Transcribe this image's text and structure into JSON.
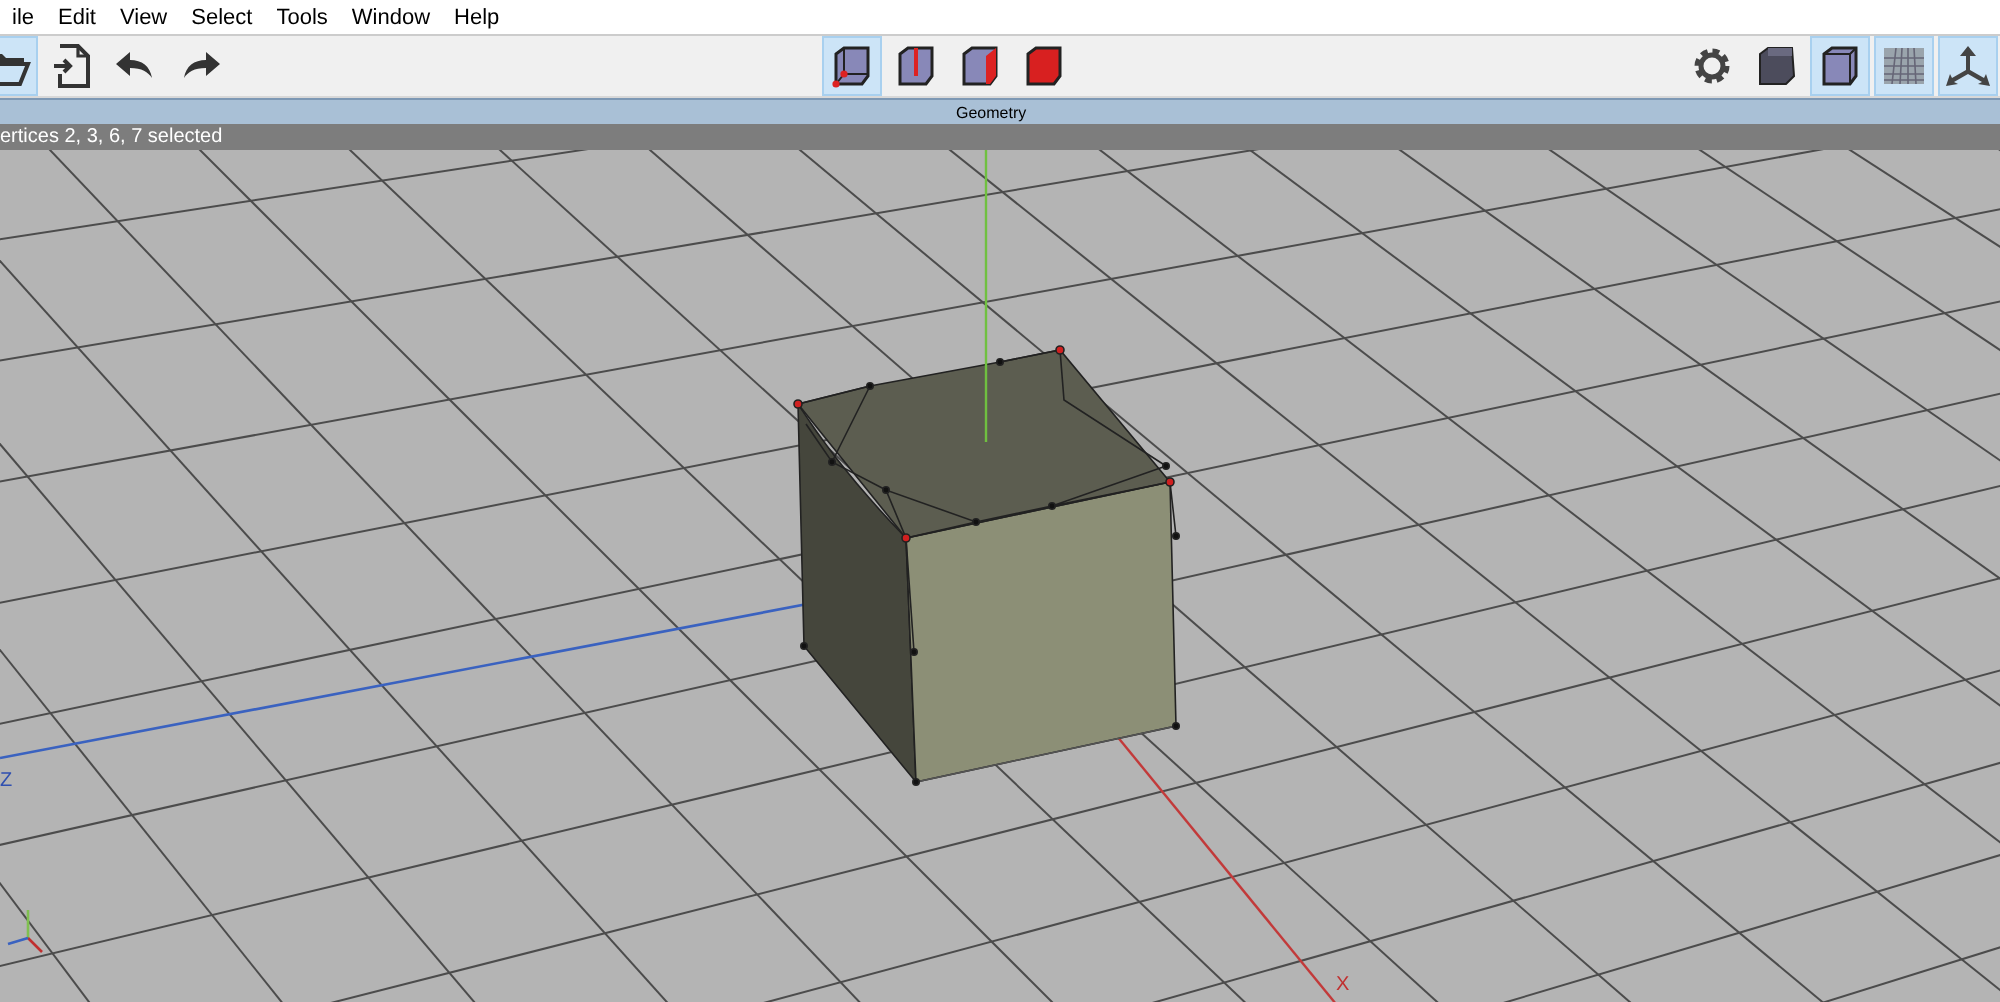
{
  "menu": [
    {
      "label": "ile"
    },
    {
      "label": "Edit"
    },
    {
      "label": "View"
    },
    {
      "label": "Select"
    },
    {
      "label": "Tools"
    },
    {
      "label": "Window"
    },
    {
      "label": "Help"
    }
  ],
  "toolbar": {
    "file_tools": [
      {
        "kind": "open",
        "selected": true
      },
      {
        "kind": "import",
        "selected": false
      },
      {
        "kind": "undo",
        "selected": false
      },
      {
        "kind": "redo",
        "selected": false
      }
    ],
    "selection_modes": [
      {
        "kind": "vertex",
        "selected": true
      },
      {
        "kind": "edge",
        "selected": false
      },
      {
        "kind": "face",
        "selected": false
      },
      {
        "kind": "object",
        "selected": false
      }
    ],
    "view_options": [
      {
        "kind": "settings",
        "selected": false
      },
      {
        "kind": "shading",
        "selected": false
      },
      {
        "kind": "wireframe",
        "selected": true
      },
      {
        "kind": "grid",
        "selected": true
      },
      {
        "kind": "axes",
        "selected": true
      }
    ]
  },
  "panel_title": "Geometry",
  "status": "ertices 2, 3, 6, 7 selected",
  "viewport": {
    "axis_labels": [
      {
        "kind": "z",
        "text": "Z"
      },
      {
        "kind": "x",
        "text": "X"
      }
    ]
  }
}
